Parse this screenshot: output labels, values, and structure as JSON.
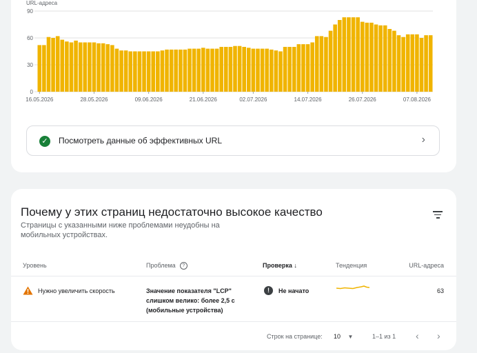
{
  "chart_data": {
    "type": "bar",
    "ylabel": "URL-адреса",
    "ylim": [
      0,
      90
    ],
    "yticks": [
      0,
      30,
      60,
      90
    ],
    "color": "#f0b400",
    "xtick_labels": [
      "16.05.2026",
      "28.05.2026",
      "09.06.2026",
      "21.06.2026",
      "02.07.2026",
      "14.07.2026",
      "26.07.2026",
      "07.08.2026"
    ],
    "xtick_indices": [
      0,
      12,
      24,
      36,
      47,
      59,
      71,
      83
    ],
    "values": [
      52,
      52,
      61,
      60,
      62,
      58,
      56,
      55,
      57,
      55,
      55,
      55,
      55,
      54,
      54,
      53,
      52,
      48,
      46,
      46,
      45,
      45,
      45,
      45,
      45,
      45,
      45,
      46,
      47,
      47,
      47,
      47,
      47,
      48,
      48,
      48,
      49,
      48,
      48,
      48,
      50,
      50,
      50,
      51,
      51,
      50,
      49,
      48,
      48,
      48,
      48,
      47,
      46,
      45,
      50,
      50,
      50,
      53,
      53,
      53,
      55,
      62,
      62,
      61,
      68,
      75,
      80,
      83,
      83,
      83,
      83,
      78,
      77,
      77,
      75,
      74,
      74,
      70,
      68,
      63,
      61,
      64,
      64,
      64,
      60,
      63,
      63
    ]
  },
  "good_url": {
    "label": "Посмотреть данные об эффективных URL",
    "check_icon": "check-circle-icon",
    "chevron_icon": "chevron-right-icon"
  },
  "issues": {
    "title": "Почему у этих страниц недостаточно высокое качество",
    "subtitle": "Страницы с указанными ниже проблемами неудобны на мобильных устройствах.",
    "columns": {
      "level": "Уровень",
      "problem": "Проблема",
      "check": "Проверка",
      "trend": "Тенденция",
      "urls": "URL-адреса"
    },
    "rows": [
      {
        "level": "Нужно увеличить скорость",
        "problem_lines": [
          "Значение показателя \"LCP\"",
          "слишком велико: более 2,5 с",
          "(мобильные устройства)"
        ],
        "check": "Не начато",
        "urls": "63"
      }
    ],
    "footer": {
      "rows_per_page_label": "Строк на странице:",
      "rows_per_page_value": "10",
      "range": "1–1 из 1"
    }
  },
  "colors": {
    "accent": "#f0b400",
    "success": "#188038",
    "warning": "#e37400"
  }
}
